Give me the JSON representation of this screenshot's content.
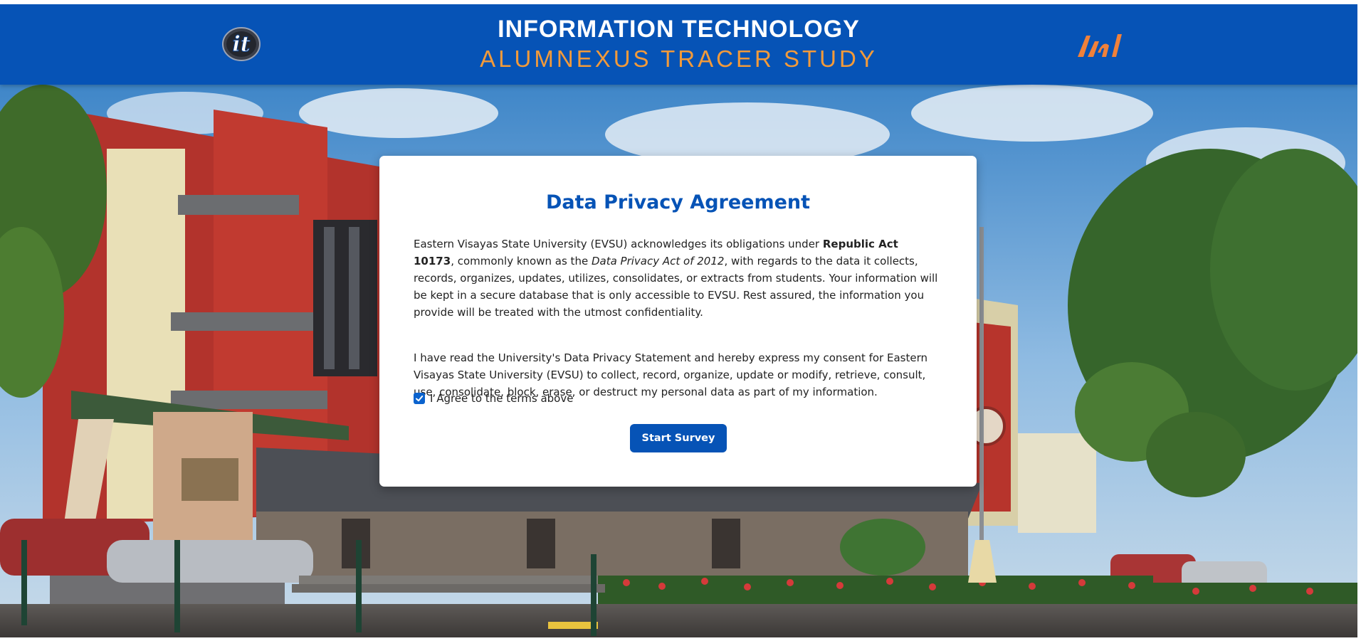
{
  "header": {
    "title": "INFORMATION TECHNOLOGY",
    "subtitle": "ALUMNEXUS TRACER STUDY",
    "left_logo_icon": "it-logo-icon",
    "right_logo_icon": "alumnexus-logo-icon",
    "left_logo_text": "it"
  },
  "agreement": {
    "title": "Data Privacy Agreement",
    "p1": {
      "part1": "Eastern Visayas State University (EVSU) acknowledges its obligations under ",
      "act": "Republic Act 10173",
      "part2": ", commonly known as the ",
      "law_name": "Data Privacy Act of 2012",
      "part3": ", with regards to the data it collects, records, organizes, updates, utilizes, consolidates, or extracts from students. Your information will be kept in a secure database that is only accessible to EVSU. Rest assured, the information you provide will be treated with the utmost confidentiality."
    },
    "p2": "I have read the University's Data Privacy Statement and hereby express my consent for Eastern Visayas State University (EVSU) to collect, record, organize, update or modify, retrieve, consult, use, consolidate, block, erase, or destruct my personal data as part of my information.",
    "checkbox_label": "I Agree to the terms above",
    "checkbox_checked": true,
    "button_label": "Start Survey"
  },
  "colors": {
    "header_bg": "#0653b6",
    "subtitle": "#f29a3a",
    "title_blue": "#0653b6",
    "button_bg": "#0653b6"
  }
}
